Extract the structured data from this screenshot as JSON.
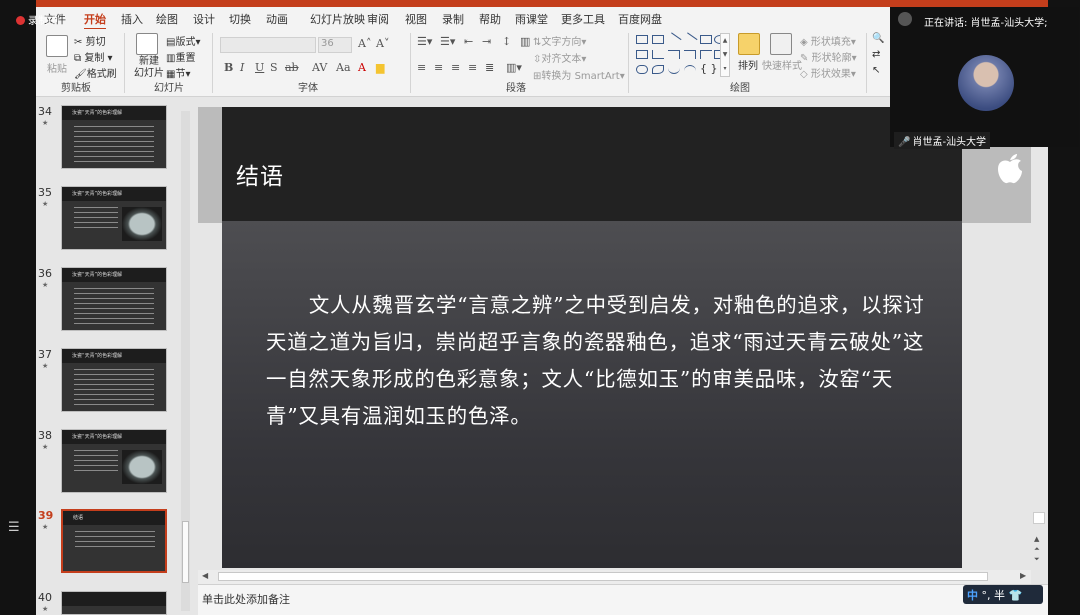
{
  "recording": {
    "label": "录制中"
  },
  "tabs": [
    "文件",
    "开始",
    "插入",
    "绘图",
    "设计",
    "切换",
    "动画",
    "幻灯片放映",
    "审阅",
    "视图",
    "录制",
    "帮助",
    "雨课堂",
    "更多工具",
    "百度网盘"
  ],
  "active_tab": "开始",
  "ribbon": {
    "clipboard": {
      "paste": "粘贴",
      "cut": "剪切",
      "copy": "复制",
      "format_painter": "格式刷",
      "group": "剪贴板"
    },
    "slides": {
      "new_slide": "新建\n幻灯片",
      "layout": "版式",
      "reset": "重置",
      "section": "节",
      "group": "幻灯片"
    },
    "font": {
      "size": "36",
      "group": "字体",
      "bold": "B",
      "italic": "I",
      "underline": "U",
      "strike": "S",
      "shadow": "ab"
    },
    "paragraph": {
      "text_direction": "文字方向",
      "align_text": "对齐文本",
      "smartart": "转换为 SmartArt",
      "group": "段落"
    },
    "drawing": {
      "arrange": "排列",
      "quick_styles": "快速样式",
      "shape_fill": "形状填充",
      "shape_outline": "形状轮廓",
      "shape_effects": "形状效果",
      "group": "绘图"
    }
  },
  "slides": [
    {
      "num": "34",
      "title": "汝瓷“天青”的色彩理解"
    },
    {
      "num": "35",
      "title": "汝瓷“天青”的色彩理解"
    },
    {
      "num": "36",
      "title": "汝瓷“天青”的色彩理解"
    },
    {
      "num": "37",
      "title": "汝瓷“天青”的色彩理解"
    },
    {
      "num": "38",
      "title": "汝瓷“天青”的色彩理解"
    },
    {
      "num": "39",
      "title": "结语"
    },
    {
      "num": "40",
      "title": ""
    }
  ],
  "current_slide": "39",
  "slide": {
    "title": "结语",
    "body": "文人从魏晋玄学“言意之辨”之中受到启发，对釉色的追求，以探讨天道之道为旨归，崇尚超乎言象的瓷器釉色，追求“雨过天青云破处”这一自然天象形成的色彩意象；文人“比德如玉”的审美品味，汝窑“天青”又具有温润如玉的色泽。"
  },
  "notes": {
    "placeholder": "单击此处添加备注"
  },
  "meeting": {
    "speaking_label": "正在讲话: 肖世孟-汕头大学;",
    "participant_name": "肖世孟-汕头大学"
  },
  "ime": {
    "mode": "中",
    "symbols": "°, 半"
  },
  "colors": {
    "accent": "#c43e1c",
    "slide_header": "#222222",
    "slide_bg": "#3a3a3e"
  }
}
